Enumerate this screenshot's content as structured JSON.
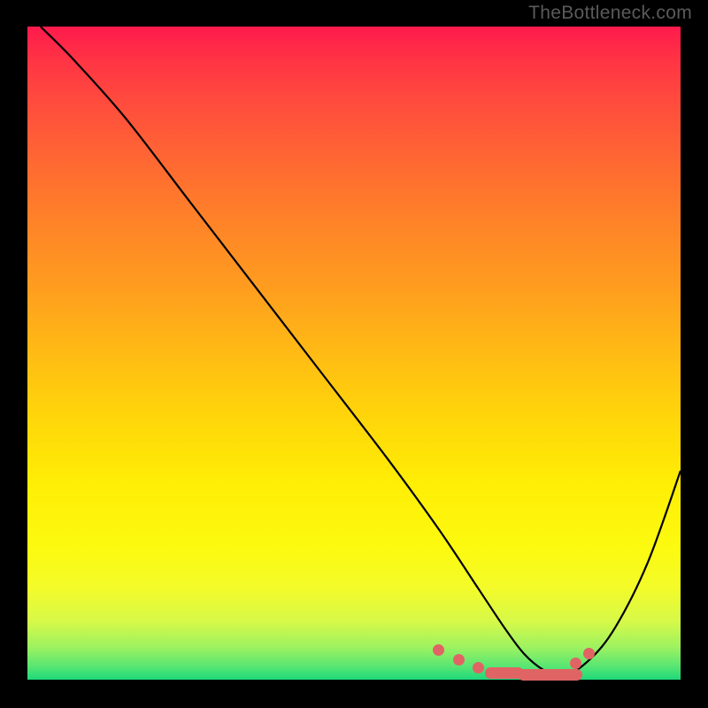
{
  "watermark": "TheBottleneck.com",
  "chart_data": {
    "type": "line",
    "title": "",
    "xlabel": "",
    "ylabel": "",
    "xlim": [
      0,
      100
    ],
    "ylim": [
      0,
      100
    ],
    "series": [
      {
        "name": "curve",
        "x": [
          2,
          7,
          15,
          25,
          35,
          45,
          55,
          63,
          69,
          73,
          76,
          79,
          82,
          86,
          90,
          95,
          100
        ],
        "values": [
          100,
          95,
          86,
          73,
          60,
          47,
          34,
          23,
          14,
          8,
          4,
          1.5,
          0.5,
          3,
          8,
          18,
          32
        ]
      }
    ],
    "markers": [
      {
        "x": 63,
        "y": 4.5,
        "kind": "dot"
      },
      {
        "x": 66,
        "y": 3.0,
        "kind": "dot"
      },
      {
        "x": 69,
        "y": 1.8,
        "kind": "dot"
      },
      {
        "x": 73,
        "y": 1.0,
        "kind": "wide",
        "w": 6
      },
      {
        "x": 80,
        "y": 0.7,
        "kind": "wide",
        "w": 10
      },
      {
        "x": 84,
        "y": 2.5,
        "kind": "dot"
      },
      {
        "x": 86,
        "y": 4.0,
        "kind": "dot"
      }
    ],
    "colors": {
      "curve": "#000000",
      "marker": "#e06464",
      "background_top": "#ff1a4d",
      "background_bottom": "#1dd97a"
    }
  }
}
